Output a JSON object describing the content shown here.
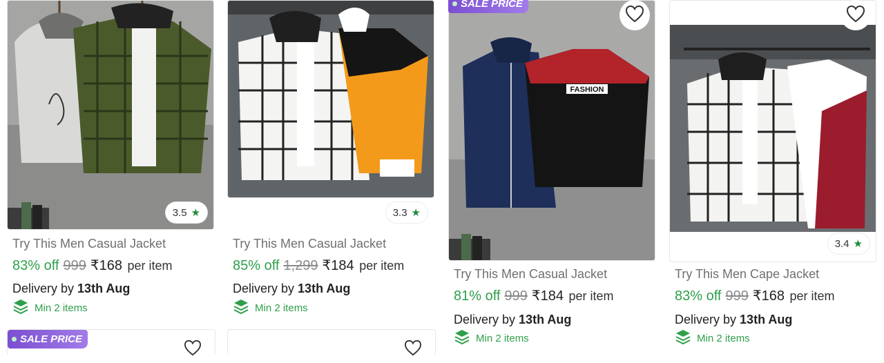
{
  "products": [
    {
      "title": "Try This Men Casual Jacket",
      "discount": "83% off",
      "mrp": "999",
      "price": "₹168",
      "per": "per item",
      "delivery_prefix": "Delivery by",
      "delivery_date": "13th Aug",
      "min_items": "Min 2 items",
      "rating": "3.5"
    },
    {
      "title": "Try This Men Casual Jacket",
      "discount": "85% off",
      "mrp": "1,299",
      "price": "₹184",
      "per": "per item",
      "delivery_prefix": "Delivery by",
      "delivery_date": "13th Aug",
      "min_items": "Min 2 items",
      "rating": "3.3"
    },
    {
      "badge": "SALE PRICE",
      "title": "Try This Men Casual Jacket",
      "discount": "81% off",
      "mrp": "999",
      "price": "₹184",
      "per": "per item",
      "delivery_prefix": "Delivery by",
      "delivery_date": "13th Aug",
      "min_items": "Min 2 items",
      "print_text": "FASHION"
    },
    {
      "title": "Try This Men Cape Jacket",
      "discount": "83% off",
      "mrp": "999",
      "price": "₹168",
      "per": "per item",
      "delivery_prefix": "Delivery by",
      "delivery_date": "13th Aug",
      "min_items": "Min 2 items",
      "rating": "3.4"
    }
  ],
  "next_row": {
    "badge": "SALE PRICE"
  },
  "colors": {
    "discount_green": "#2e9f4a",
    "star_green": "#1f8a3b",
    "sale_badge_purple": "#7b4fd1"
  },
  "icons": [
    "heart-icon",
    "star-icon",
    "stack-icon"
  ]
}
